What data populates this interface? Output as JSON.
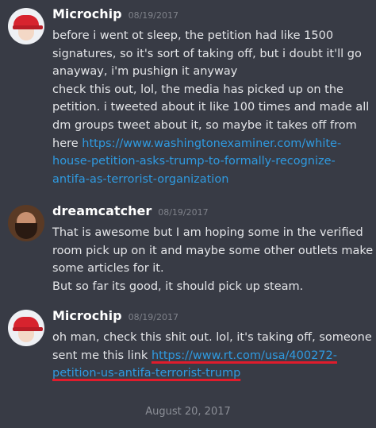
{
  "messages": [
    {
      "username": "Microchip",
      "avatar_icon": "red-hat-avatar",
      "timestamp": "08/19/2017",
      "lines": [
        [
          {
            "text": "before i went ot sleep, the petition had like 1500"
          }
        ],
        [
          {
            "text": "signatures, so it's sort of taking off, but i doubt it'll go"
          }
        ],
        [
          {
            "text": "anayway, i'm pushign it anyway"
          }
        ],
        [
          {
            "text": "check this out, lol, the media has picked up on the"
          }
        ],
        [
          {
            "text": "petition. i tweeted about it like 100 times and made all"
          }
        ],
        [
          {
            "text": "dm groups tweet about it, so maybe it takes off from"
          }
        ],
        [
          {
            "text": "here "
          },
          {
            "text": "https://www.washingtonexaminer.com/white-",
            "link": true
          }
        ],
        [
          {
            "text": "house-petition-asks-trump-to-formally-recognize-",
            "link": true
          }
        ],
        [
          {
            "text": "antifa-as-terrorist-organization",
            "link": true
          }
        ]
      ]
    },
    {
      "username": "dreamcatcher",
      "avatar_icon": "bearded-man-avatar",
      "timestamp": "08/19/2017",
      "lines": [
        [
          {
            "text": "That is awesome but I am hoping some in the verified"
          }
        ],
        [
          {
            "text": "room pick up on it and maybe some other outlets make"
          }
        ],
        [
          {
            "text": "some articles for it."
          }
        ],
        [
          {
            "text": "But so far its good, it should pick up steam."
          }
        ]
      ]
    },
    {
      "username": "Microchip",
      "avatar_icon": "red-hat-avatar",
      "timestamp": "08/19/2017",
      "lines": [
        [
          {
            "text": "oh man, check this shit out. lol, it's taking off, someone"
          }
        ],
        [
          {
            "text": "sent me this link "
          },
          {
            "text": "https://www.rt.com/usa/400272-",
            "link": true,
            "underlined": true
          }
        ],
        [
          {
            "text": "petition-us-antifa-terrorist-trump",
            "link": true,
            "underlined": true
          }
        ]
      ]
    }
  ],
  "date_divider": "August 20, 2017",
  "colors": {
    "background": "#383b45",
    "link": "#2f9ae0",
    "underline": "#e01c2c"
  }
}
